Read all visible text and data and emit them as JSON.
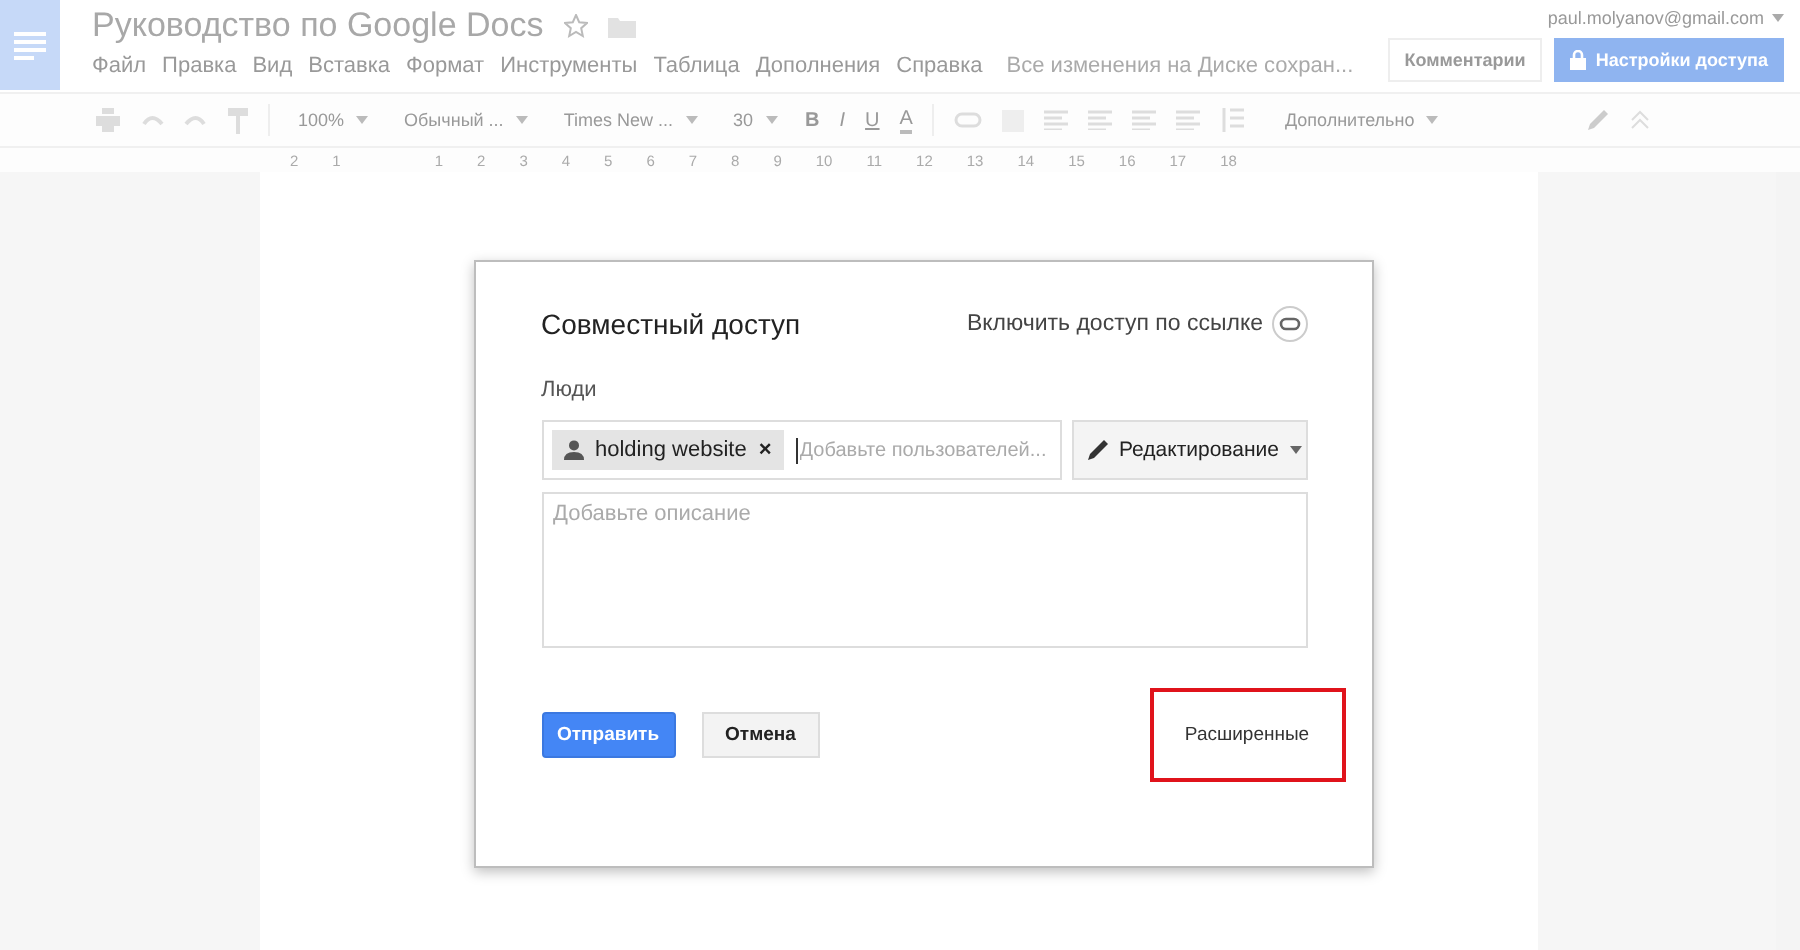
{
  "document": {
    "title": "Руководство по Google Docs",
    "save_status": "Все изменения на Диске сохран...",
    "account": "paul.molyanov@gmail.com"
  },
  "menu": [
    "Файл",
    "Правка",
    "Вид",
    "Вставка",
    "Формат",
    "Инструменты",
    "Таблица",
    "Дополнения",
    "Справка"
  ],
  "header_buttons": {
    "comments": "Комментарии",
    "share": "Настройки доступа"
  },
  "toolbar": {
    "zoom": "100%",
    "style": "Обычный ...",
    "font": "Times New ...",
    "size": "30",
    "bold": "B",
    "italic": "I",
    "underline": "U",
    "text_color_letter": "A",
    "more": "Дополнительно"
  },
  "ruler": [
    "2",
    "1",
    "1",
    "2",
    "3",
    "4",
    "5",
    "6",
    "7",
    "8",
    "9",
    "10",
    "11",
    "12",
    "13",
    "14",
    "15",
    "16",
    "17",
    "18"
  ],
  "dialog": {
    "title": "Совместный доступ",
    "link_toggle": "Включить доступ по ссылке",
    "people_label": "Люди",
    "chips": [
      {
        "label": "holding website",
        "remove": "×"
      }
    ],
    "people_placeholder": "Добавьте пользователей...",
    "permission": "Редактирование",
    "note_placeholder": "Добавьте описание",
    "send": "Отправить",
    "cancel": "Отмена",
    "advanced": "Расширенные",
    "advanced_highlighted": true
  }
}
